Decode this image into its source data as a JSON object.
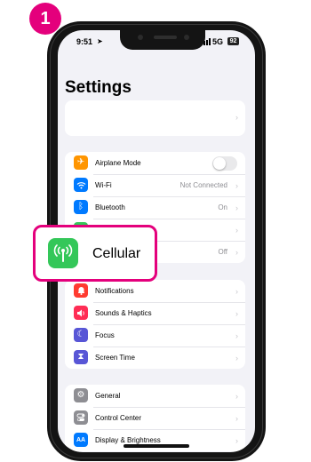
{
  "step_number": "1",
  "status_bar": {
    "time": "9:51",
    "location_glyph": "➤",
    "network": "5G",
    "battery": "92"
  },
  "page_title": "Settings",
  "top_card": {
    "chevron": "›"
  },
  "group1": [
    {
      "label": "Airplane Mode",
      "value": "",
      "icon": "airplane-icon",
      "color": "#ff9500",
      "glyph": "✈",
      "toggle": true
    },
    {
      "label": "Wi-Fi",
      "value": "Not Connected",
      "icon": "wifi-icon",
      "color": "#007aff",
      "glyph": "◠"
    },
    {
      "label": "Bluetooth",
      "value": "On",
      "icon": "bluetooth-icon",
      "color": "#007aff",
      "glyph": "ᛒ"
    },
    {
      "label": "",
      "value": "",
      "icon": "cellular-icon",
      "color": "#34c759",
      "glyph": ""
    },
    {
      "label": "",
      "value": "Off",
      "icon": "hotspot-icon",
      "color": "#34c759",
      "glyph": ""
    }
  ],
  "group2": [
    {
      "label": "Notifications",
      "icon": "bell-icon",
      "color": "#ff3b30",
      "glyph": "🔔"
    },
    {
      "label": "Sounds & Haptics",
      "icon": "speaker-icon",
      "color": "#ff2d55",
      "glyph": "◀"
    },
    {
      "label": "Focus",
      "icon": "moon-icon",
      "color": "#5856d6",
      "glyph": "☾"
    },
    {
      "label": "Screen Time",
      "icon": "hourglass-icon",
      "color": "#5856d6",
      "glyph": "⧗"
    }
  ],
  "group3": [
    {
      "label": "General",
      "icon": "gear-icon",
      "color": "#8e8e93",
      "glyph": "⚙"
    },
    {
      "label": "Control Center",
      "icon": "toggles-icon",
      "color": "#8e8e93",
      "glyph": "◉"
    },
    {
      "label": "Display & Brightness",
      "icon": "display-icon",
      "color": "#007aff",
      "glyph": "AA"
    }
  ],
  "callout": {
    "label": "Cellular",
    "color": "#e4007c"
  },
  "chevron": "›"
}
